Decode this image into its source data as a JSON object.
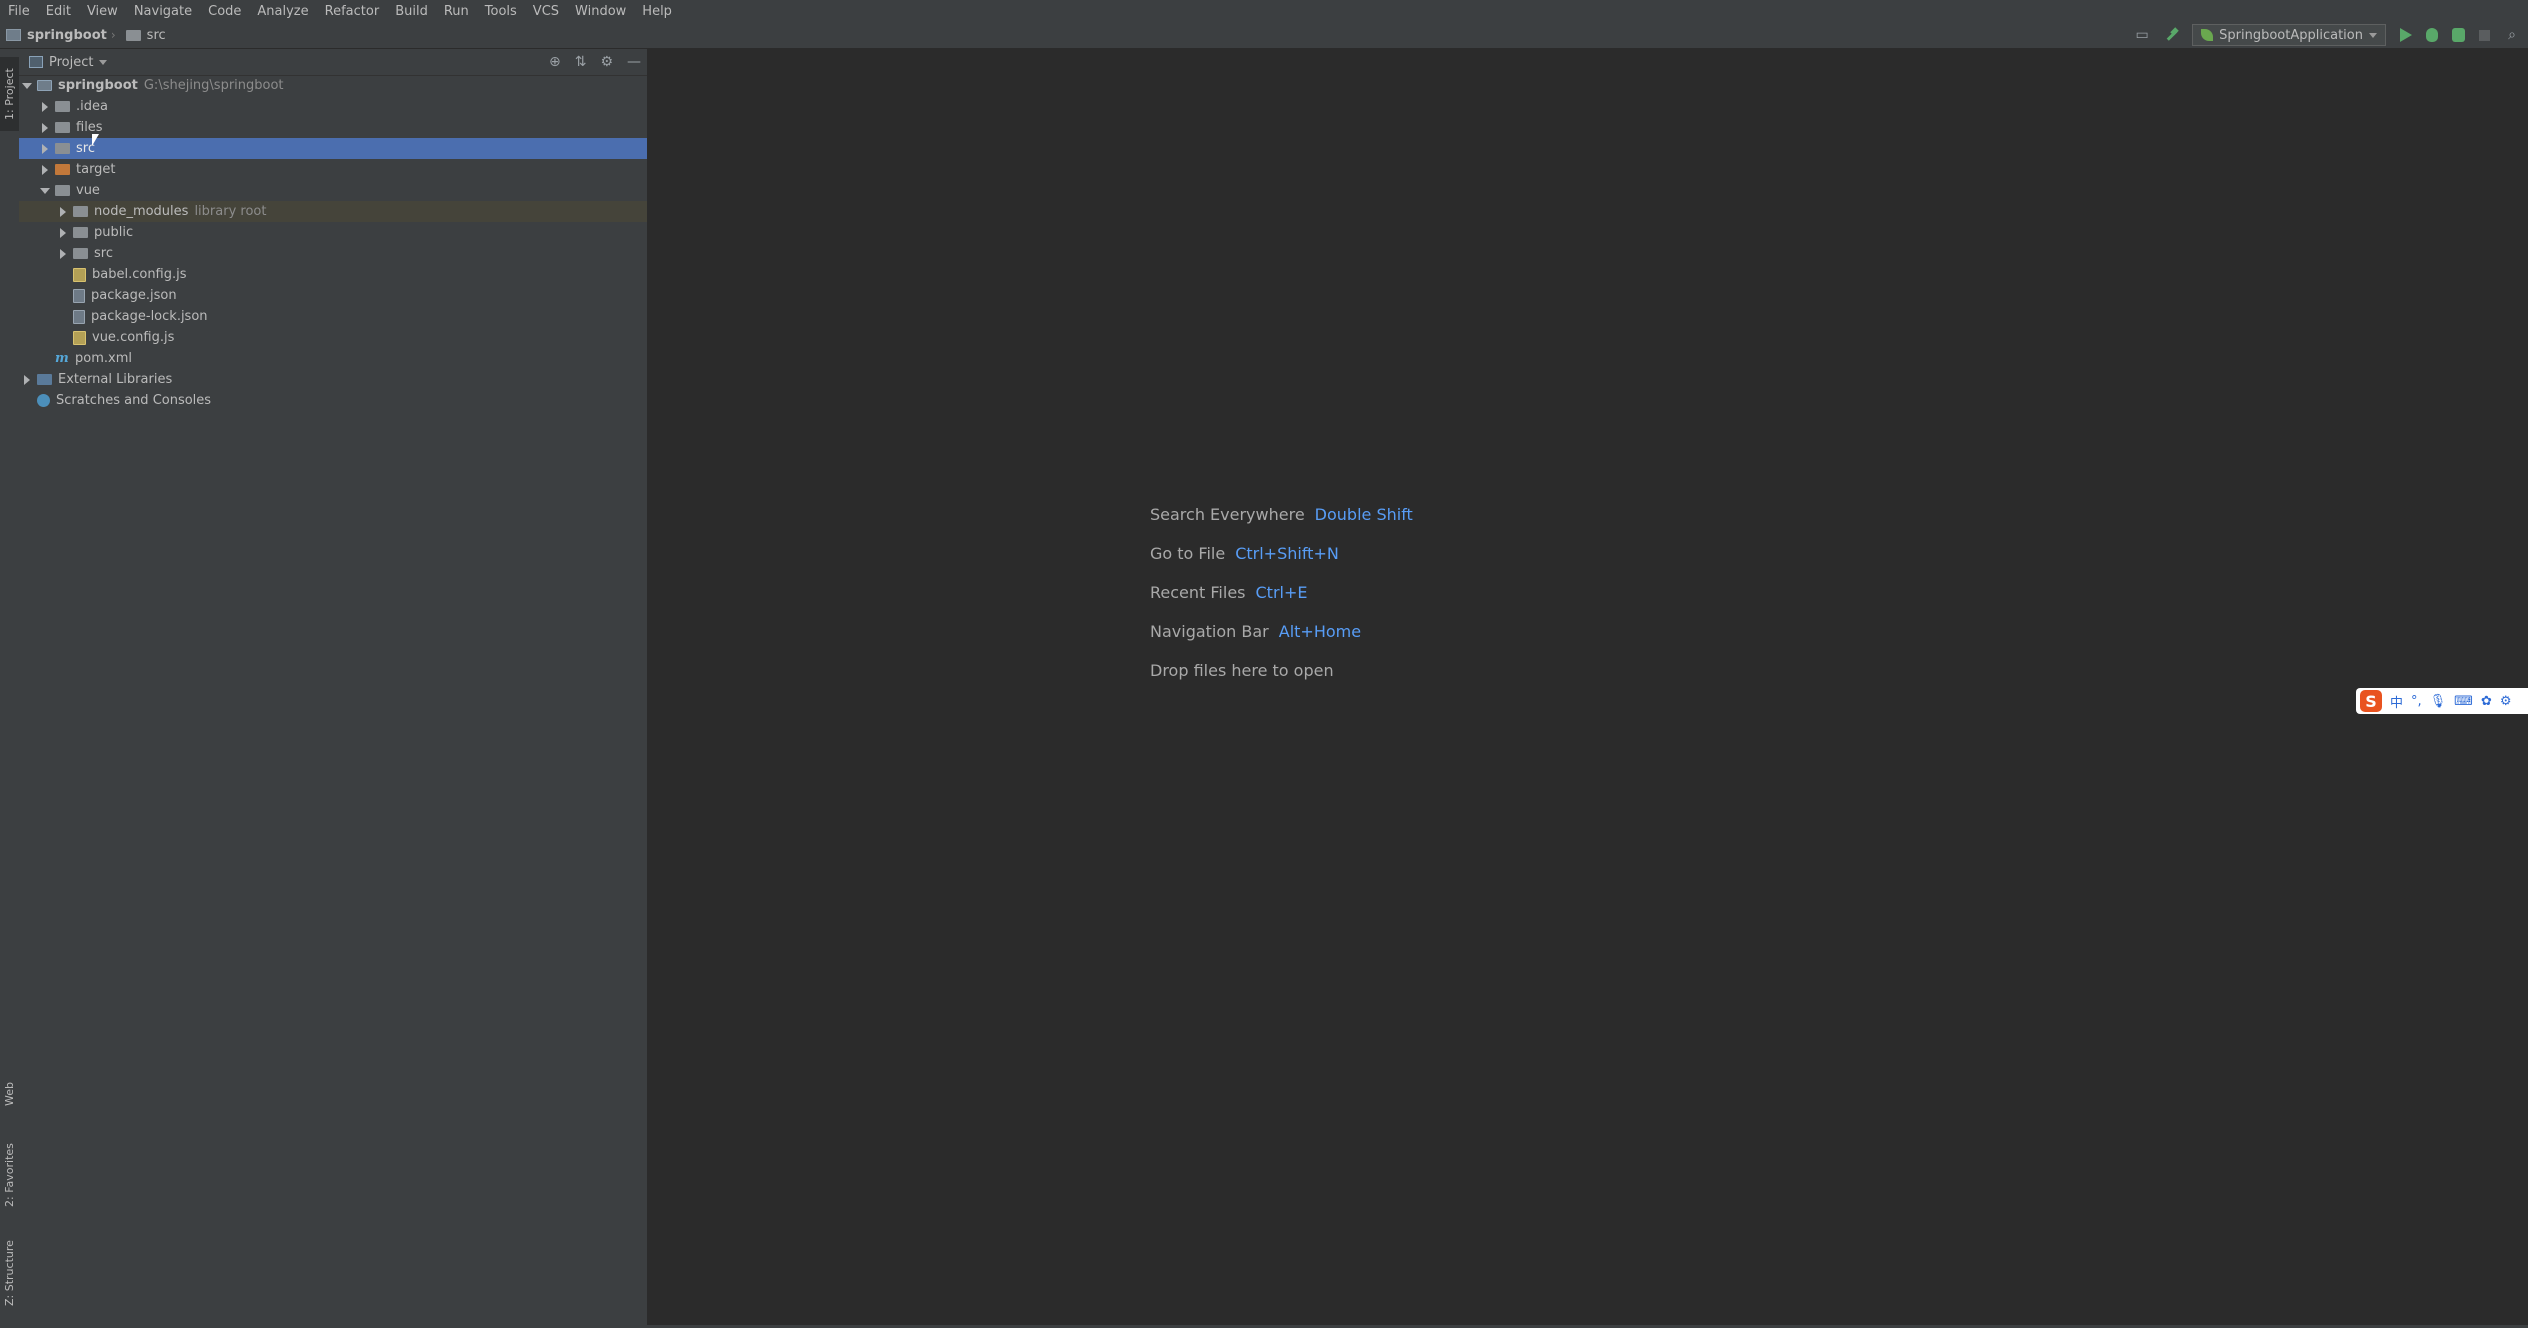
{
  "menu": [
    "File",
    "Edit",
    "View",
    "Navigate",
    "Code",
    "Analyze",
    "Refactor",
    "Build",
    "Run",
    "Tools",
    "VCS",
    "Window",
    "Help"
  ],
  "breadcrumb": {
    "project": "springboot",
    "folder": "src"
  },
  "toolbar": {
    "run_config": "SpringbootApplication"
  },
  "stripe": {
    "project": "1: Project",
    "web": "Web",
    "favorites": "2: Favorites",
    "structure": "Z: Structure"
  },
  "panel": {
    "title": "Project"
  },
  "tree": {
    "root_name": "springboot",
    "root_path": "G:\\shejing\\springboot",
    "idea": ".idea",
    "files": "files",
    "src": "src",
    "target": "target",
    "vue": "vue",
    "node_modules": "node_modules",
    "node_modules_note": "library root",
    "public": "public",
    "vue_src": "src",
    "babel": "babel.config.js",
    "package": "package.json",
    "package_lock": "package-lock.json",
    "vue_config": "vue.config.js",
    "pom": "pom.xml",
    "ext_libs": "External Libraries",
    "scratches": "Scratches and Consoles"
  },
  "hints": [
    {
      "label": "Search Everywhere",
      "key": "Double Shift"
    },
    {
      "label": "Go to File",
      "key": "Ctrl+Shift+N"
    },
    {
      "label": "Recent Files",
      "key": "Ctrl+E"
    },
    {
      "label": "Navigation Bar",
      "key": "Alt+Home"
    },
    {
      "label": "Drop files here to open",
      "key": ""
    }
  ],
  "ime": {
    "logo": "S",
    "lang": "中"
  },
  "icons": {
    "project": "project-icon",
    "folder": "folder-icon",
    "run": "run-icon",
    "debug": "debug-icon",
    "coverage": "coverage-icon",
    "stop": "stop-icon",
    "search": "search-icon",
    "build": "hammer-icon"
  },
  "colors": {
    "selection": "#4b6eaf",
    "hint_key": "#589df6",
    "run_green": "#59a869"
  }
}
